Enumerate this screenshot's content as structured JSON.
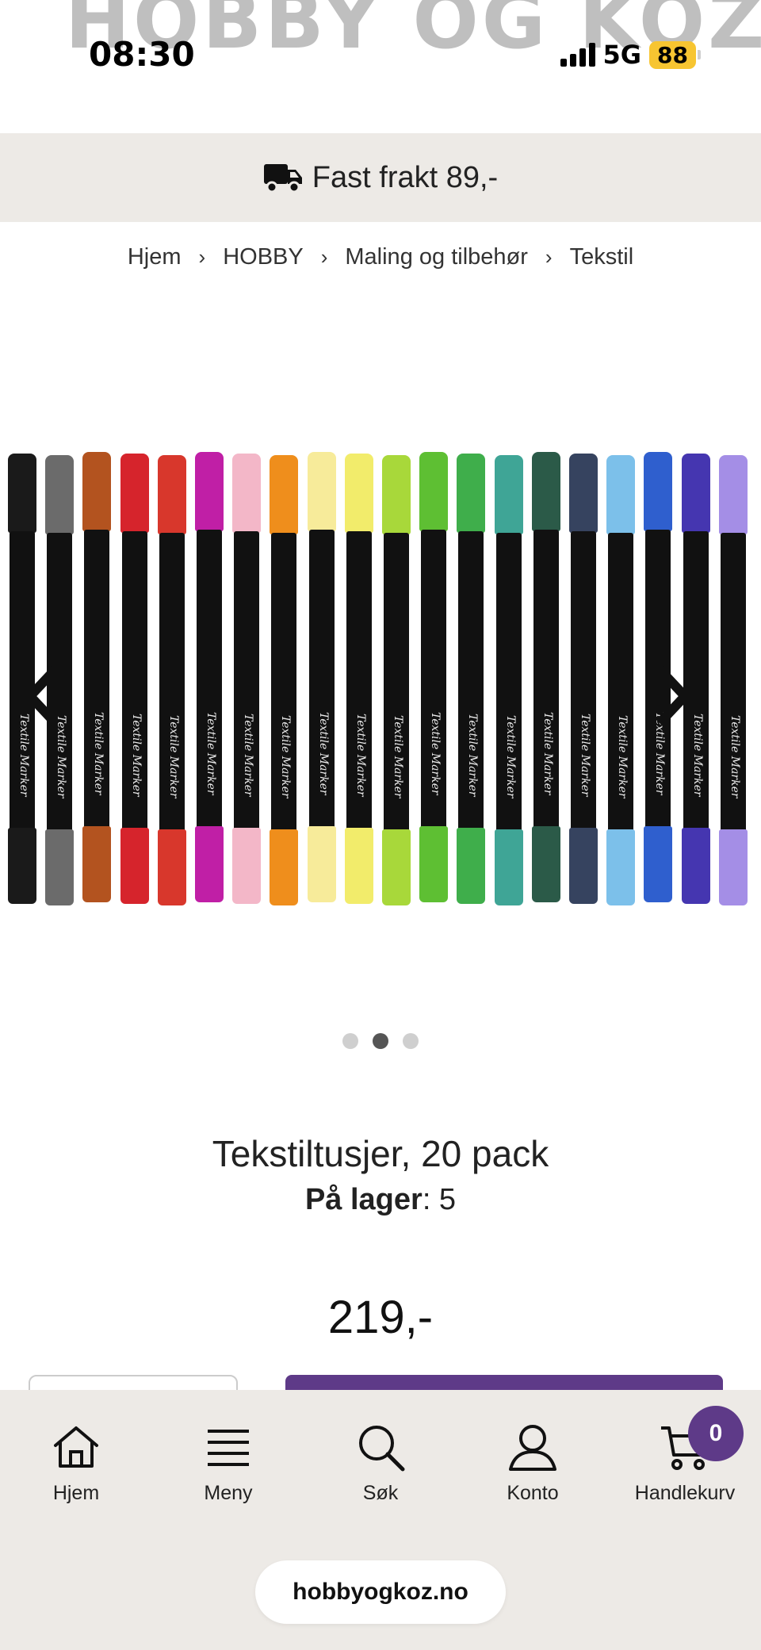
{
  "status_bar": {
    "time": "08:30",
    "network": "5G",
    "battery": "88",
    "site_name_behind": "HOBBY OG KOZ"
  },
  "shipping_banner": {
    "icon": "truck-icon",
    "text": "Fast frakt 89,-"
  },
  "breadcrumb": [
    "Hjem",
    "HOBBY",
    "Maling og tilbehør",
    "Tekstil"
  ],
  "gallery": {
    "marker_label": "Textile Marker",
    "marker_colors": [
      "#1a1a1a",
      "#6b6b6b",
      "#b3531f",
      "#d6242c",
      "#d8372c",
      "#c01fa6",
      "#f3b7c8",
      "#ef8e1c",
      "#f7eb9a",
      "#f2ec6b",
      "#a8d83a",
      "#5ebf33",
      "#3fae4b",
      "#3fa596",
      "#2b5a48",
      "#36435f",
      "#7cc0ea",
      "#2f5fce",
      "#4536b0",
      "#a48ee6"
    ],
    "slide_count": 3,
    "active_slide": 2,
    "prev_icon": "chevron-left-icon",
    "next_icon": "chevron-right-icon"
  },
  "product": {
    "title": "Tekstiltusjer, 20 pack",
    "stock_label": "På lager",
    "stock_value": ": 5",
    "price": "219,-"
  },
  "bottom_nav": {
    "items": [
      {
        "label": "Hjem",
        "icon": "home-icon"
      },
      {
        "label": "Meny",
        "icon": "menu-icon"
      },
      {
        "label": "Søk",
        "icon": "search-icon"
      },
      {
        "label": "Konto",
        "icon": "user-icon"
      },
      {
        "label": "Handlekurv",
        "icon": "cart-icon"
      }
    ],
    "cart_count": "0"
  },
  "url": "hobbyogkoz.no",
  "colors": {
    "accent": "#5e3a88",
    "banner_bg": "#edeae6"
  }
}
